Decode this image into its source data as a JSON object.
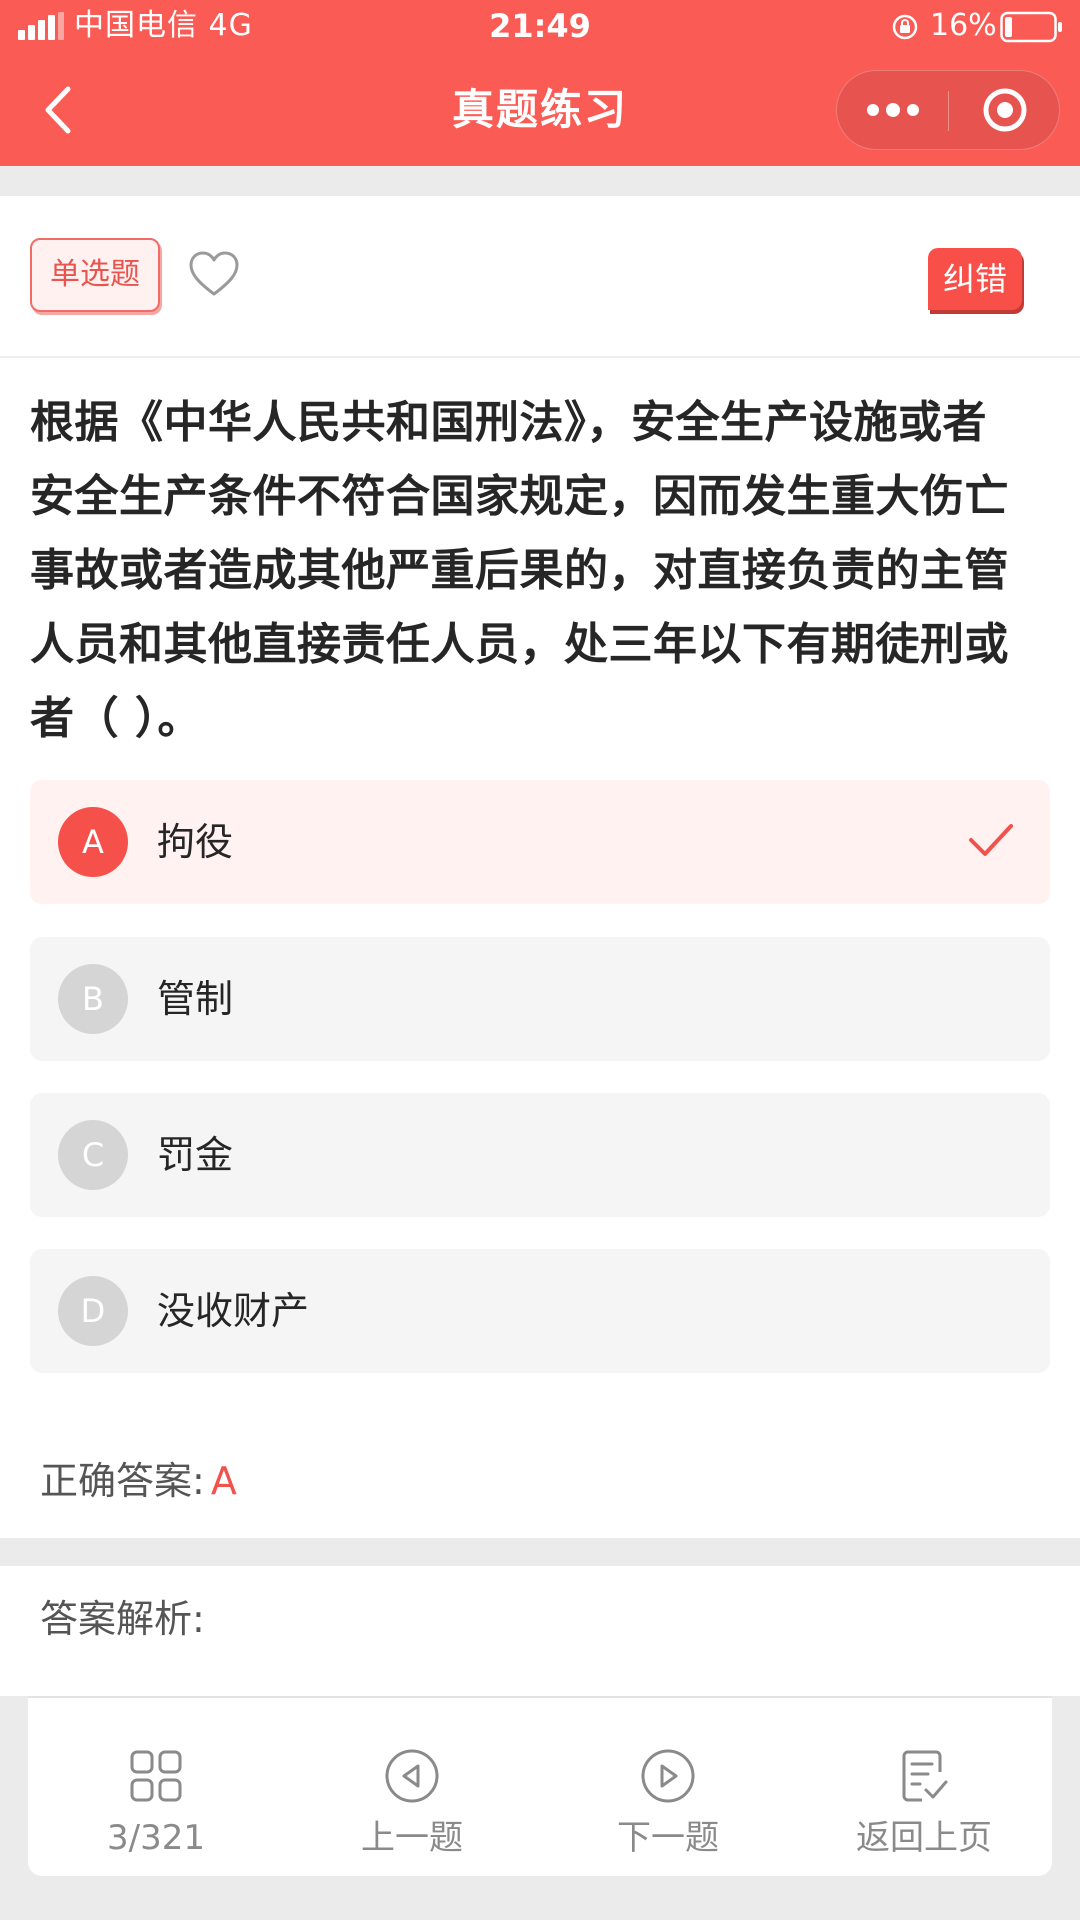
{
  "status_bar": {
    "carrier": "中国电信  4G",
    "time": "21:49",
    "battery_percent": "16%"
  },
  "header": {
    "title": "真题练习",
    "icons": [
      "back-arrow-icon",
      "more-dots-icon",
      "close-target-icon"
    ]
  },
  "question": {
    "type_label": "单选题",
    "report_label": "纠错",
    "text": "根据《中华人民共和国刑法》，安全生产设施或者安全生产条件不符合国家规定，因而发生重大伤亡事故或者造成其他严重后果的，对直接负责的主管人员和其他直接责任人员，处三年以下有期徒刑或者（ ）。",
    "options": [
      {
        "letter": "A",
        "text": "拘役",
        "selected": true
      },
      {
        "letter": "B",
        "text": "管制",
        "selected": false
      },
      {
        "letter": "C",
        "text": "罚金",
        "selected": false
      },
      {
        "letter": "D",
        "text": "没收财产",
        "selected": false
      }
    ],
    "answer_label": "正确答案:",
    "answer_value": "A"
  },
  "analysis": {
    "title": "答案解析:"
  },
  "bottom_nav": {
    "items": [
      {
        "label": "3/321",
        "icon": "grid-icon"
      },
      {
        "label": "上一题",
        "icon": "prev-circle-icon"
      },
      {
        "label": "下一题",
        "icon": "next-circle-icon"
      },
      {
        "label": "返回上页",
        "icon": "checklist-icon"
      }
    ]
  },
  "colors": {
    "primary": "#fb5b55",
    "accent_text": "#f2524c",
    "option_bg": "#f5f5f5",
    "selected_bg": "#fff2f1"
  }
}
